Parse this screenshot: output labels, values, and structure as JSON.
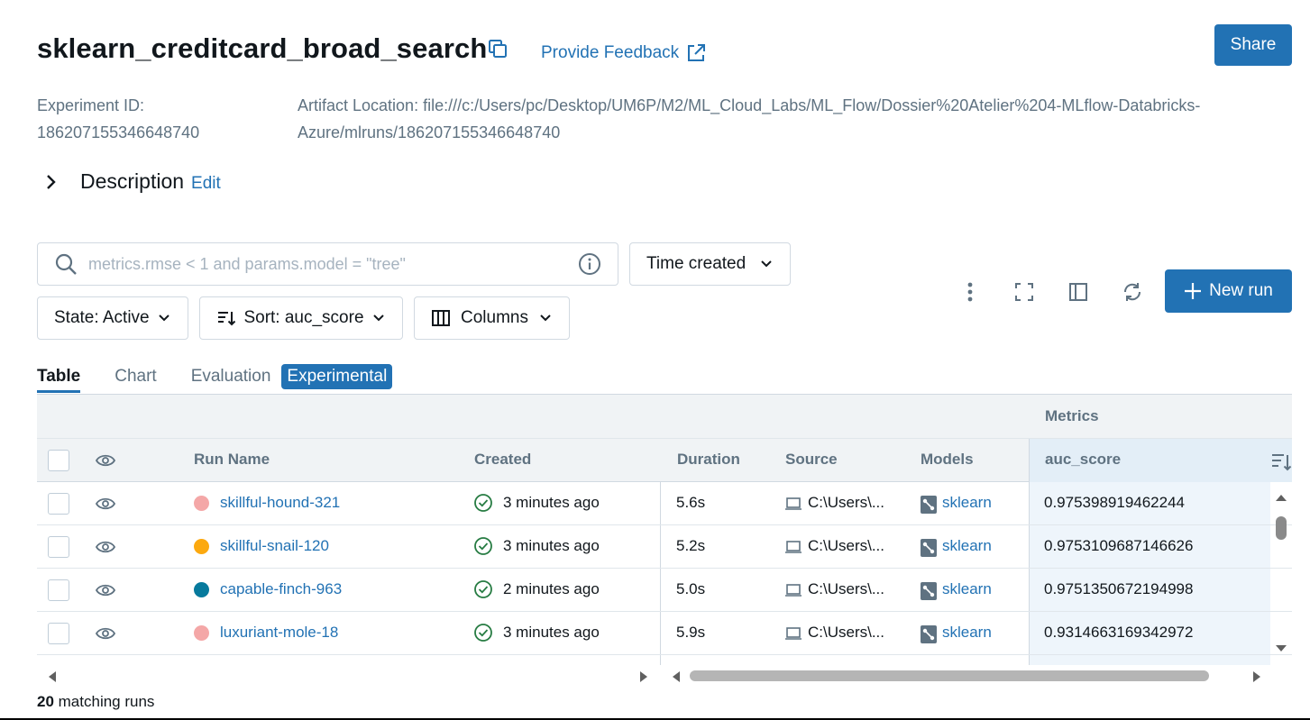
{
  "header": {
    "title": "sklearn_creditcard_broad_search",
    "feedback_label": "Provide Feedback",
    "share_label": "Share"
  },
  "meta": {
    "experiment_id_label": "Experiment ID:",
    "experiment_id": "186207155346648740",
    "artifact_location_line1": "Artifact Location: file:///c:/Users/pc/Desktop/UM6P/M2/ML_Cloud_Labs/ML_Flow/Dossier%20Atelier%204-MLflow-Databricks-",
    "artifact_location_line2": "Azure/mlruns/186207155346648740"
  },
  "description": {
    "label": "Description",
    "edit_label": "Edit"
  },
  "toolbar": {
    "search_placeholder": "metrics.rmse < 1 and params.model = \"tree\"",
    "time_label": "Time created",
    "state_label": "State: Active",
    "sort_label": "Sort: auc_score",
    "columns_label": "Columns",
    "new_run_label": "New run"
  },
  "tabs": [
    {
      "label": "Table",
      "active": true
    },
    {
      "label": "Chart",
      "active": false
    },
    {
      "label": "Evaluation",
      "active": false
    }
  ],
  "experimental_badge": "Experimental",
  "table": {
    "group_header": "Metrics",
    "columns": {
      "run_name": "Run Name",
      "created": "Created",
      "duration": "Duration",
      "source": "Source",
      "models": "Models",
      "auc_score": "auc_score"
    },
    "rows": [
      {
        "name": "skillful-hound-321",
        "color": "#f4a7a7",
        "created": "3 minutes ago",
        "duration": "5.6s",
        "source": "C:\\Users\\...",
        "model": "sklearn",
        "auc": "0.975398919462244"
      },
      {
        "name": "skillful-snail-120",
        "color": "#fca90f",
        "created": "3 minutes ago",
        "duration": "5.2s",
        "source": "C:\\Users\\...",
        "model": "sklearn",
        "auc": "0.9753109687146626"
      },
      {
        "name": "capable-finch-963",
        "color": "#077a9d",
        "created": "2 minutes ago",
        "duration": "5.0s",
        "source": "C:\\Users\\...",
        "model": "sklearn",
        "auc": "0.9751350672194998"
      },
      {
        "name": "luxuriant-mole-18",
        "color": "#f4a7a7",
        "created": "3 minutes ago",
        "duration": "5.9s",
        "source": "C:\\Users\\...",
        "model": "sklearn",
        "auc": "0.9314663169342972"
      }
    ]
  },
  "footer": {
    "count": "20",
    "text": " matching runs"
  },
  "colors": {
    "accent": "#2272b4",
    "success": "#277c43"
  }
}
